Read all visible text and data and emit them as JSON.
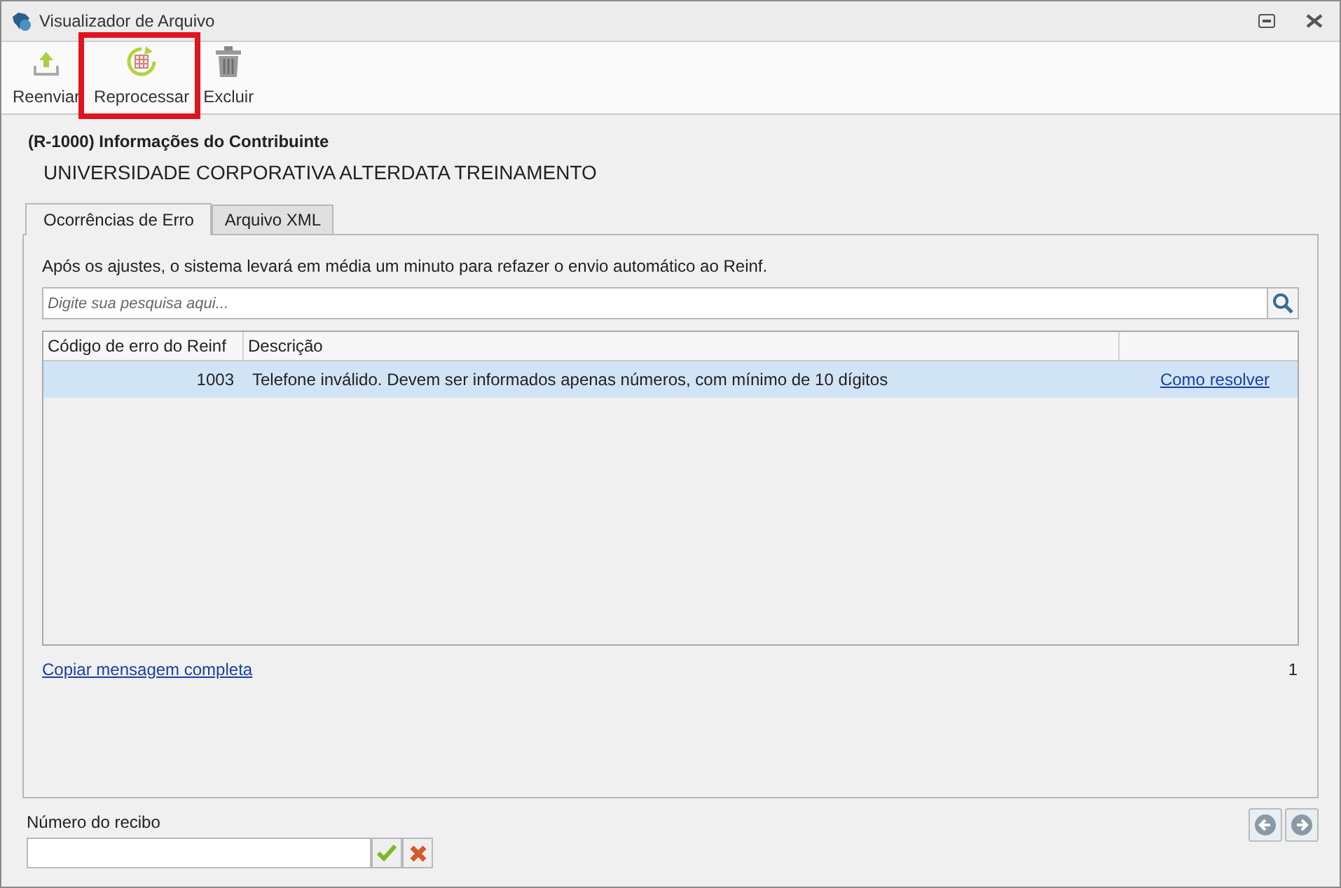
{
  "window": {
    "title": "Visualizador de Arquivo"
  },
  "toolbar": [
    {
      "kind": "upload",
      "label": "Reenviar",
      "highlighted": false
    },
    {
      "kind": "reprocess",
      "label": "Reprocessar",
      "highlighted": true
    },
    {
      "kind": "delete",
      "label": "Excluir",
      "highlighted": false
    }
  ],
  "header": {
    "event": "(R-1000) Informações do Contribuinte",
    "company": "UNIVERSIDADE CORPORATIVA ALTERDATA TREINAMENTO"
  },
  "tabs": [
    {
      "label": "Ocorrências de Erro",
      "selected": true
    },
    {
      "label": "Arquivo XML",
      "selected": false
    }
  ],
  "message": "Após os ajustes, o sistema levará em média um minuto para refazer o envio automático ao Reinf.",
  "search": {
    "placeholder": "Digite sua pesquisa aqui..."
  },
  "table": {
    "columns": [
      "Código de erro do Reinf",
      "Descrição"
    ],
    "rows": [
      {
        "code": "1003",
        "description": "Telefone inválido. Devem ser informados apenas números, com mínimo de 10 dígitos",
        "link": "Como resolver",
        "selected": true
      }
    ]
  },
  "copy_link": "Copiar mensagem completa",
  "count": "1",
  "receipt": {
    "label": "Número do recibo"
  }
}
